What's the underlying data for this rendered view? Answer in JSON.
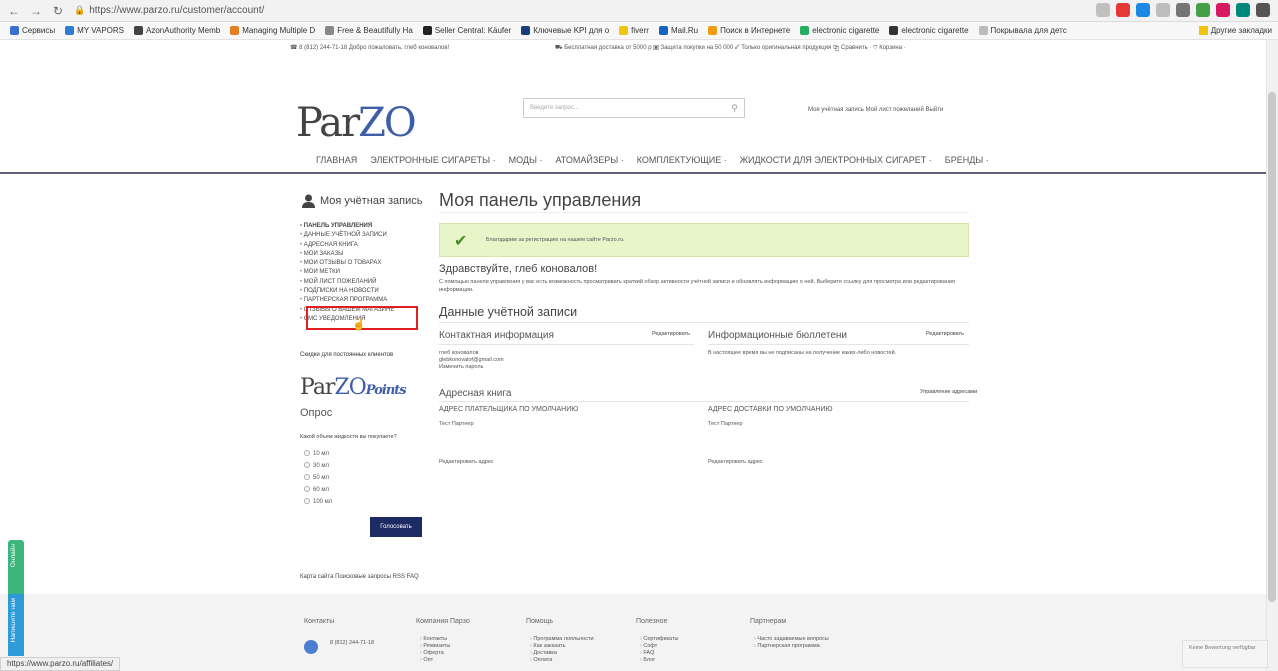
{
  "browser": {
    "url": "https://www.parzo.ru/customer/account/",
    "bookmarks": [
      "Сервисы",
      "MY VAPORS",
      "AzonAuthority Memb",
      "Managing Multiple D",
      "Free & Beautifully Ha",
      "Seller Central: Käufer",
      "Ключевые KPI для о",
      "fiverr",
      "Mail.Ru",
      "Поиск в Интернете",
      "electronic cigarette",
      "electronic cigarette",
      "Покрывала для детс"
    ],
    "other_bookmarks": "Другие закладки",
    "status_url": "https://www.parzo.ru/affiliates/"
  },
  "header": {
    "topline": "☎ 8 (812) 244-71-18 Добро пожаловать, глеб коновалов!",
    "topline_mid": "⛟ Бесплатная доставка от 5000 р  ▣ Защита покупки на 50 000  ✓ Только оригинальная продукция  ⧉ Сравнить ·  ⛉ Корзина ·",
    "logo_par": "Par",
    "logo_zo": "ZO",
    "search_placeholder": "Введите запрос...",
    "account_links": "Моя учётная запись   Мой лист пожеланий   Выйти"
  },
  "nav": [
    "ГЛАВНАЯ",
    "ЭЛЕКТРОННЫЕ СИГАРЕТЫ ·",
    "МОДЫ ·",
    "АТОМАЙЗЕРЫ ·",
    "КОМПЛЕКТУЮЩИЕ ·",
    "ЖИДКОСТИ ДЛЯ ЭЛЕКТРОННЫХ СИГАРЕТ ·",
    "БРЕНДЫ ·"
  ],
  "sidebar": {
    "title": "Моя учётная запись",
    "items": [
      "ПАНЕЛЬ УПРАВЛЕНИЯ",
      "ДАННЫЕ УЧЁТНОЙ ЗАПИСИ",
      "АДРЕСНАЯ КНИГА",
      "МОИ ЗАКАЗЫ",
      "МОИ ОТЗЫВЫ О ТОВАРАХ",
      "МОИ МЕТКИ",
      "МОЙ ЛИСТ ПОЖЕЛАНИЙ",
      "ПОДПИСКИ НА НОВОСТИ",
      "ПАРТНЕРСКАЯ ПРОГРАММА",
      "ОТЗЫВЫ О ВАШЕМ МАГАЗИНЕ",
      "СМС УВЕДОМЛЕНИЯ"
    ],
    "sale_link": "Скидки для постоянных клиентов",
    "points_logo_par": "Par",
    "points_logo_zo": "ZO",
    "points_logo_points": "Points",
    "poll": {
      "title": "Опрос",
      "question": "Какой объем жидкости вы покупаете?",
      "options": [
        "10 мл",
        "30 мл",
        "50 мл",
        "60 мл",
        "100 мл"
      ],
      "vote_label": "Голосовать"
    }
  },
  "main": {
    "title": "Моя панель управления",
    "success_message": "Благодарим за регистрацию на нашем сайте Parzo.ru.",
    "hello": "Здравствуйте, глеб коновалов!",
    "hello_sub": "С помощью панели управления у вас есть возможность просматривать краткий обзор активности учётной записи и обновлять информацию о ней. Выберите ссылку для просмотра или редактирования информации.",
    "account_data_title": "Данные учётной записи",
    "contact": {
      "title": "Контактная информация",
      "edit": "Редактировать",
      "name": "глеб коновалов",
      "email": "glebkonovalof@gmail.com",
      "change_password": "Изменить пароль"
    },
    "newsletter": {
      "title": "Информационные бюллетени",
      "edit": "Редактировать",
      "text": "В настоящее время вы не подписаны на получение каких-либо новостей."
    },
    "address_book": {
      "title": "Адресная книга",
      "manage": "Управление адресами",
      "billing_title": "АДРЕС ПЛАТЕЛЬЩИКА ПО УМОЛЧАНИЮ",
      "billing_name": "Тест Партнер",
      "billing_edit": "Редактировать адрес",
      "shipping_title": "АДРЕС ДОСТАВКИ ПО УМОЛЧАНИЮ",
      "shipping_name": "Тест Партнер",
      "shipping_edit": "Редактировать адрес"
    }
  },
  "footer": {
    "links": "Карта сайта   Поисковые запросы   RSS   FAQ",
    "cols": [
      {
        "title": "Контакты",
        "items": []
      },
      {
        "title": "Компания Парзо",
        "items": [
          "Контакты",
          "Реквизиты",
          "Оферта",
          "Опт"
        ]
      },
      {
        "title": "Помощь",
        "items": [
          "Программа лояльности",
          "Как заказать",
          "Доставка",
          "Оплата"
        ]
      },
      {
        "title": "Полезное",
        "items": [
          "Сертификаты",
          "Софт",
          "FAQ",
          "Блог"
        ]
      },
      {
        "title": "Партнерам",
        "items": [
          "Часто задаваемые вопросы",
          "Партнерская программа"
        ]
      }
    ],
    "phone": "8 (812) 244-71-18"
  },
  "widgets": {
    "green_tab": "Онлайн",
    "blue_tab": "Напишите нам",
    "badge": "Keine Bewertung verfügbar"
  },
  "colors": {
    "accent": "#1e2a63",
    "success_bg": "#e8f5c8",
    "highlight": "#e02020",
    "nav_line": "#5f6276"
  }
}
